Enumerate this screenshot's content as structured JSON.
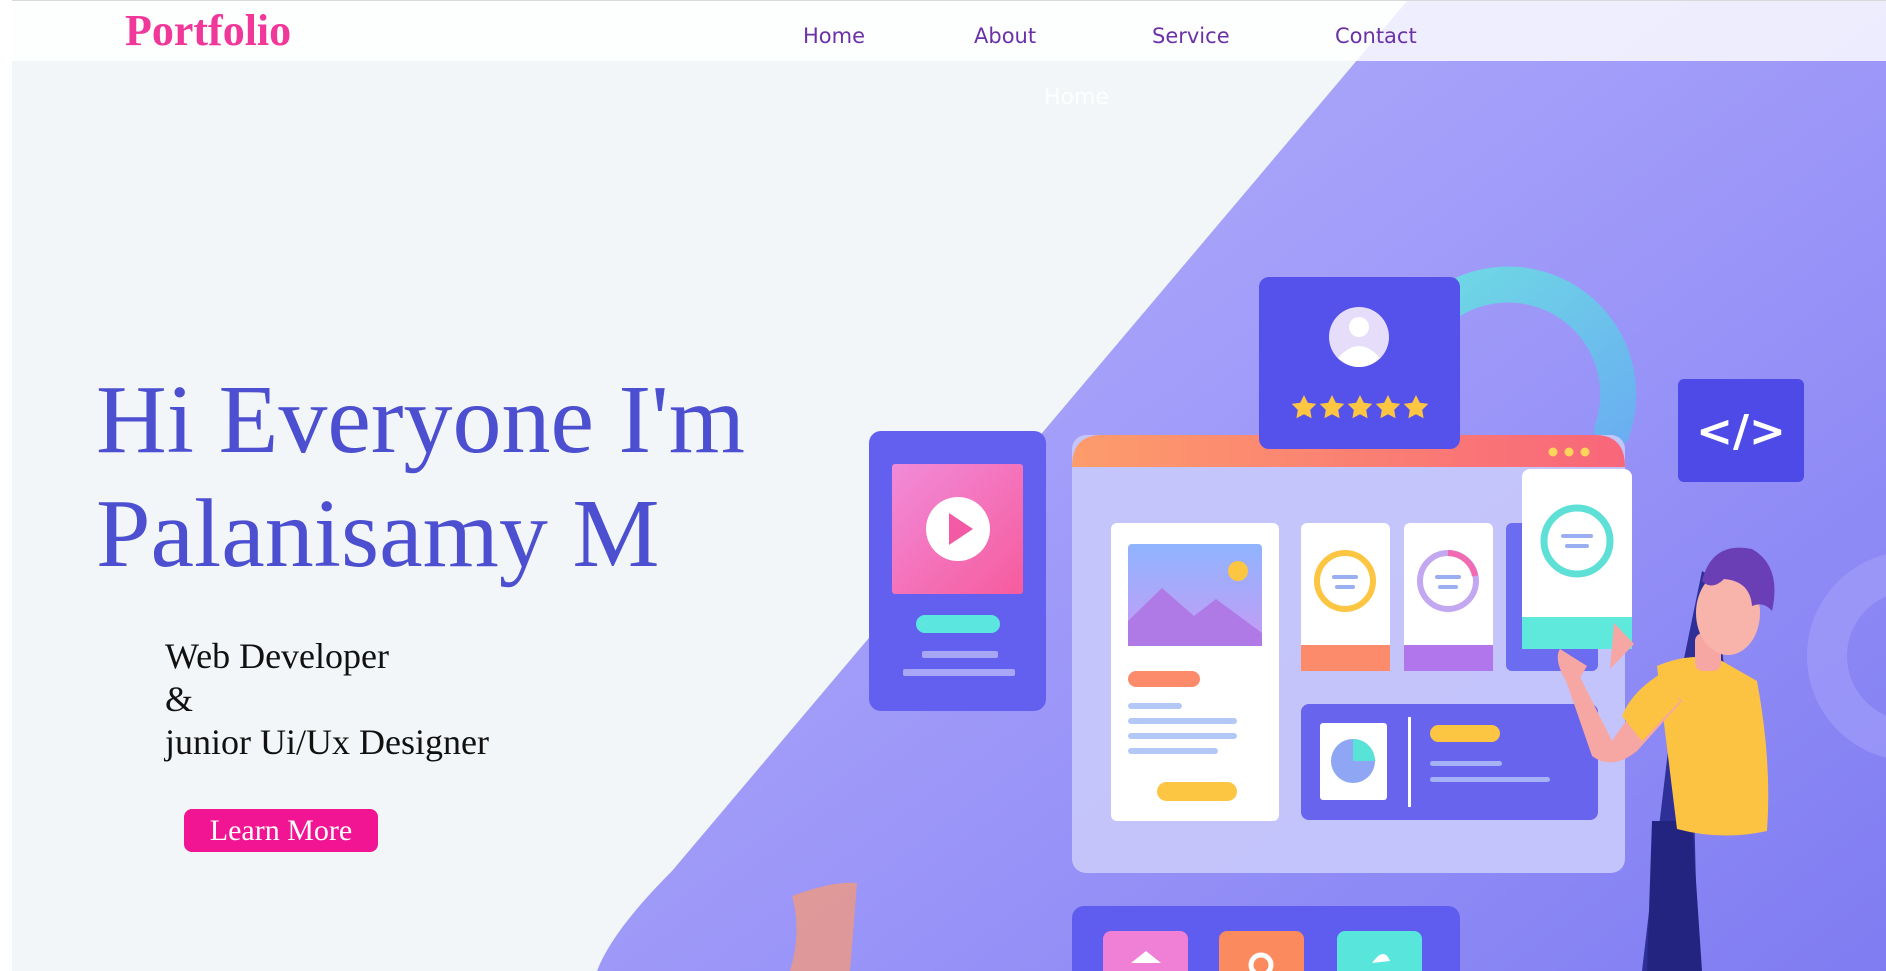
{
  "header": {
    "logo": "Portfolio",
    "nav": [
      {
        "label": "Home"
      },
      {
        "label": "About"
      },
      {
        "label": "Service"
      },
      {
        "label": "Contact"
      }
    ],
    "ghost_label": "Home"
  },
  "hero": {
    "title_line1": "Hi Everyone I'm",
    "title_line2": "Palanisamy M",
    "roles": [
      "Web Developer",
      "&",
      "junior Ui/Ux Designer"
    ],
    "cta_label": "Learn More"
  },
  "illustration": {
    "colors": {
      "background_shape": "#8c86f7",
      "card_primary": "#5d5af0",
      "accent_pink": "#f15aa8",
      "accent_orange": "#fb8b5e",
      "accent_teal": "#58e6dc",
      "accent_yellow": "#fcc542"
    },
    "rating_stars": 5,
    "code_badge": "</>"
  }
}
